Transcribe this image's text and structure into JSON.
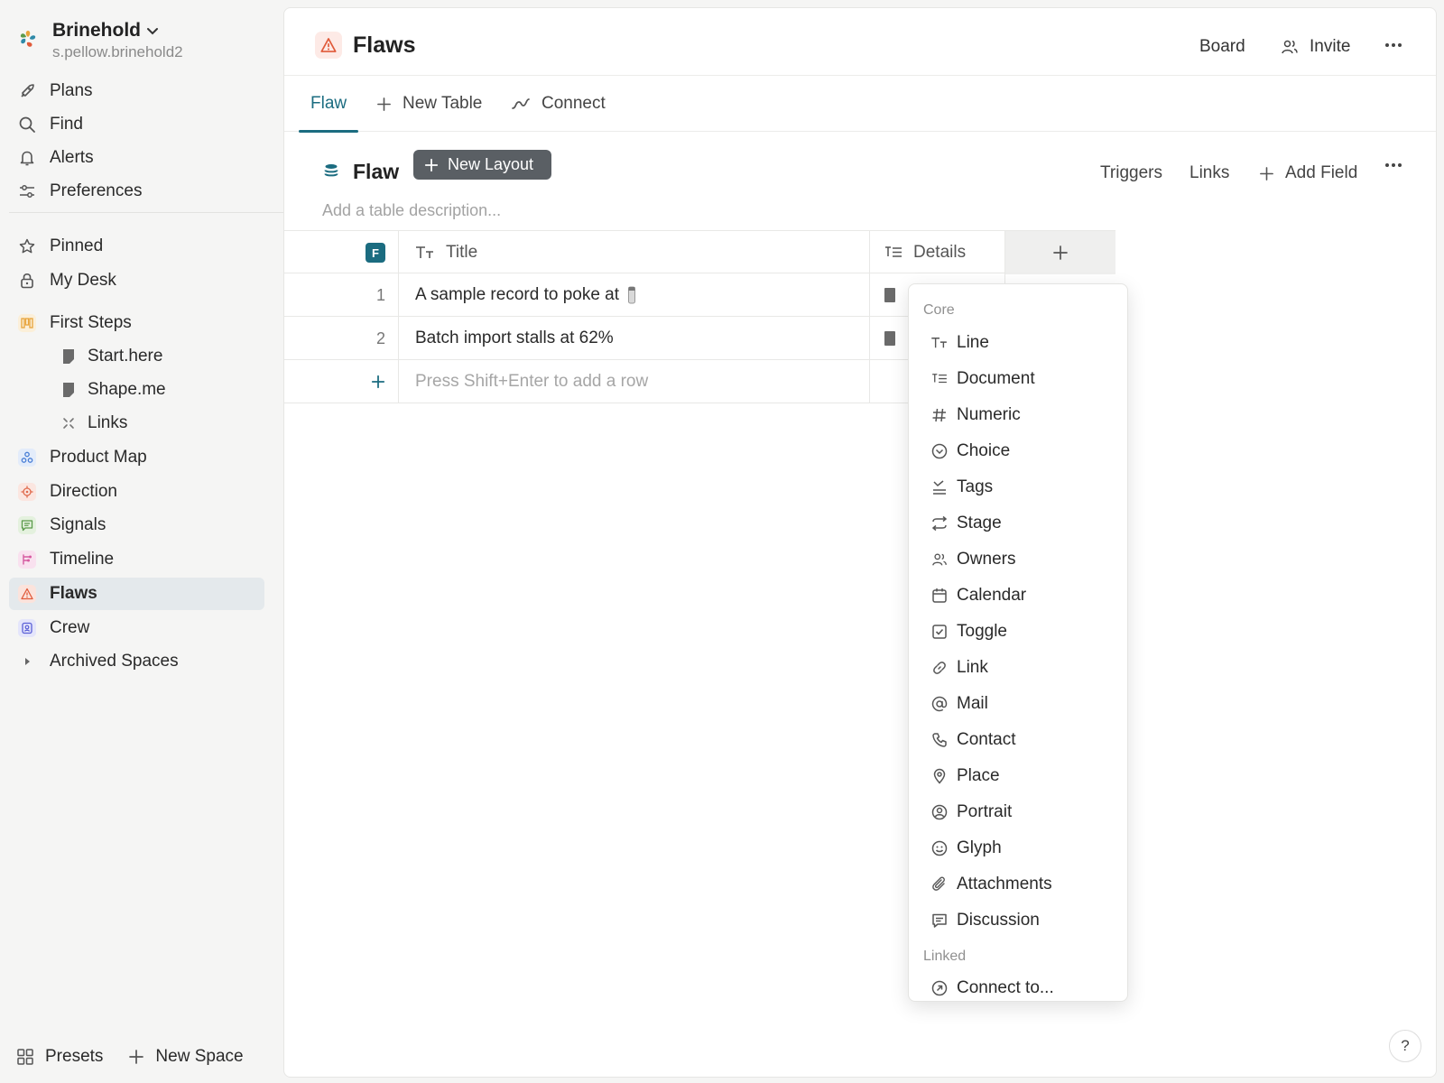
{
  "workspace": {
    "name": "Brinehold",
    "account": "s.pellow.brinehold2"
  },
  "sidebar": {
    "primary": [
      {
        "label": "Plans",
        "icon": "rocket-icon"
      },
      {
        "label": "Find",
        "icon": "search-icon"
      },
      {
        "label": "Alerts",
        "icon": "bell-icon"
      },
      {
        "label": "Preferences",
        "icon": "sliders-icon"
      }
    ],
    "spaces": [
      {
        "label": "Pinned",
        "icon": "star-icon"
      },
      {
        "label": "My Desk",
        "icon": "lock-icon"
      },
      {
        "label": "First Steps",
        "icon": "board-icon",
        "color": "#e8a33b"
      },
      {
        "label": "Start.here",
        "icon": "doc-icon"
      },
      {
        "label": "Shape.me",
        "icon": "doc-icon"
      },
      {
        "label": "Links",
        "icon": "link-x-icon"
      },
      {
        "label": "Product Map",
        "icon": "nodes-icon",
        "color": "#4a7fd6"
      },
      {
        "label": "Direction",
        "icon": "target-icon",
        "color": "#e06a4c"
      },
      {
        "label": "Signals",
        "icon": "chat-icon",
        "color": "#5a9a4a"
      },
      {
        "label": "Timeline",
        "icon": "timeline-icon",
        "color": "#d65aa0"
      },
      {
        "label": "Flaws",
        "icon": "warning-icon",
        "color": "#e05a3a"
      },
      {
        "label": "Crew",
        "icon": "badge-icon",
        "color": "#5a5fd6"
      },
      {
        "label": "Archived Spaces",
        "icon": "caret-right-icon"
      }
    ],
    "bottom": {
      "presets": "Presets",
      "new_space": "New Space"
    }
  },
  "page": {
    "title": "Flaws",
    "board": "Board",
    "invite": "Invite"
  },
  "tabs": [
    {
      "label": "Flaw"
    },
    {
      "label": "New Table"
    },
    {
      "label": "Connect"
    }
  ],
  "table": {
    "title": "Flaw",
    "new_layout": "New Layout",
    "triggers": "Triggers",
    "links": "Links",
    "add_field": "Add Field",
    "description_placeholder": "Add a table description...",
    "columns": {
      "badge": "F",
      "title": "Title",
      "details": "Details"
    },
    "rows": [
      {
        "num": "1",
        "title": "A sample record to poke at"
      },
      {
        "num": "2",
        "title": "Batch import stalls at 62%"
      }
    ],
    "add_row_hint": "Press Shift+Enter to add a row"
  },
  "field_menu": {
    "core_label": "Core",
    "core": [
      {
        "label": "Line",
        "icon": "text-icon"
      },
      {
        "label": "Document",
        "icon": "long-text-icon"
      },
      {
        "label": "Numeric",
        "icon": "hash-icon"
      },
      {
        "label": "Choice",
        "icon": "chevron-circle-icon"
      },
      {
        "label": "Tags",
        "icon": "tags-icon"
      },
      {
        "label": "Stage",
        "icon": "swap-icon"
      },
      {
        "label": "Owners",
        "icon": "people-icon"
      },
      {
        "label": "Calendar",
        "icon": "calendar-icon"
      },
      {
        "label": "Toggle",
        "icon": "checkbox-icon"
      },
      {
        "label": "Link",
        "icon": "link-icon"
      },
      {
        "label": "Mail",
        "icon": "at-icon"
      },
      {
        "label": "Contact",
        "icon": "phone-icon"
      },
      {
        "label": "Place",
        "icon": "pin-icon"
      },
      {
        "label": "Portrait",
        "icon": "person-circle-icon"
      },
      {
        "label": "Glyph",
        "icon": "smiley-icon"
      },
      {
        "label": "Attachments",
        "icon": "paperclip-icon"
      },
      {
        "label": "Discussion",
        "icon": "comment-icon"
      }
    ],
    "linked_label": "Linked",
    "linked": [
      {
        "label": "Connect to...",
        "icon": "arrow-circle-icon"
      }
    ]
  },
  "help": "?"
}
